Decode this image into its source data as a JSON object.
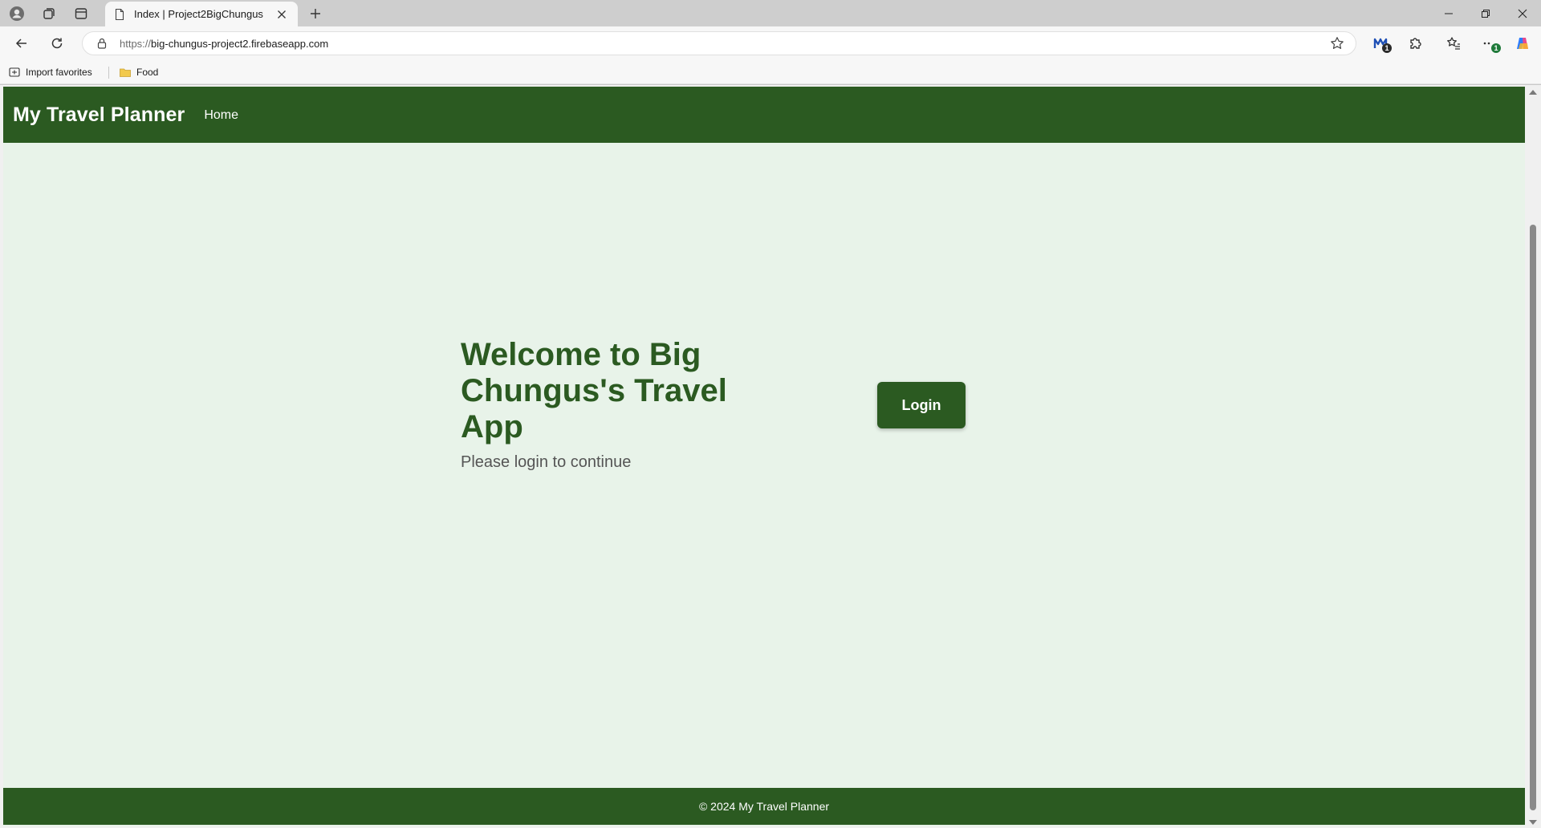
{
  "browser": {
    "tab": {
      "title": "Index | Project2BigChungus"
    },
    "address": {
      "protocol": "https://",
      "host": "big-chungus-project2.firebaseapp.com"
    },
    "toolbar_badges": {
      "extension_badge": "1",
      "menu_badge": "1"
    },
    "bookmarks": [
      {
        "label": "Import favorites",
        "icon": "import-favorites-icon"
      },
      {
        "label": "Food",
        "icon": "folder-icon"
      }
    ],
    "colors": {
      "folder": "#f2c94c",
      "copilot_gradient": [
        "#2b7cff",
        "#e84a8a",
        "#f7b52c"
      ],
      "badge_green": "#1f7a3a"
    }
  },
  "page": {
    "navbar": {
      "brand": "My Travel Planner",
      "links": [
        "Home"
      ]
    },
    "hero": {
      "title": "Welcome to Big Chungus's Travel App",
      "subtitle": "Please login to continue"
    },
    "login_button": "Login",
    "footer": "© 2024 My Travel Planner",
    "colors": {
      "primary": "#2b5a21",
      "background": "#e8f3e9",
      "text_muted": "#555555"
    }
  }
}
